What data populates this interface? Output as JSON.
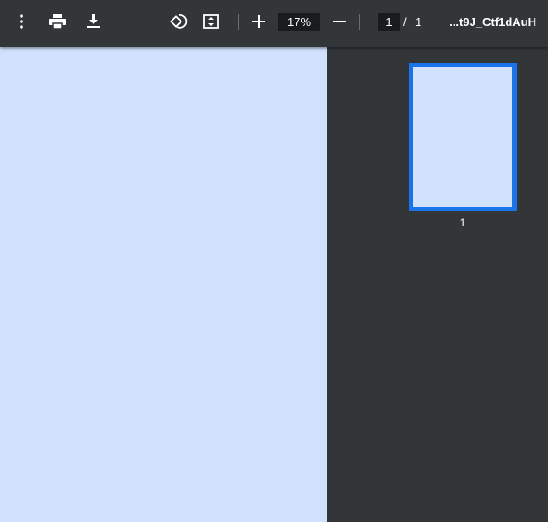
{
  "toolbar": {
    "menu_icon": "more-vert-icon",
    "print_icon": "print-icon",
    "download_icon": "download-icon",
    "rotate_icon": "rotate-icon",
    "fit_icon": "fit-page-icon",
    "zoom_value": "17%",
    "page_current": "1",
    "page_separator": "/",
    "page_total": "1",
    "title": "...t9J_Ctf1dAuH"
  },
  "sidebar": {
    "thumbnails": [
      {
        "label": "1"
      }
    ]
  },
  "colors": {
    "page": "#d1e2ff",
    "accent": "#1a73e8",
    "toolbar": "#323639"
  }
}
